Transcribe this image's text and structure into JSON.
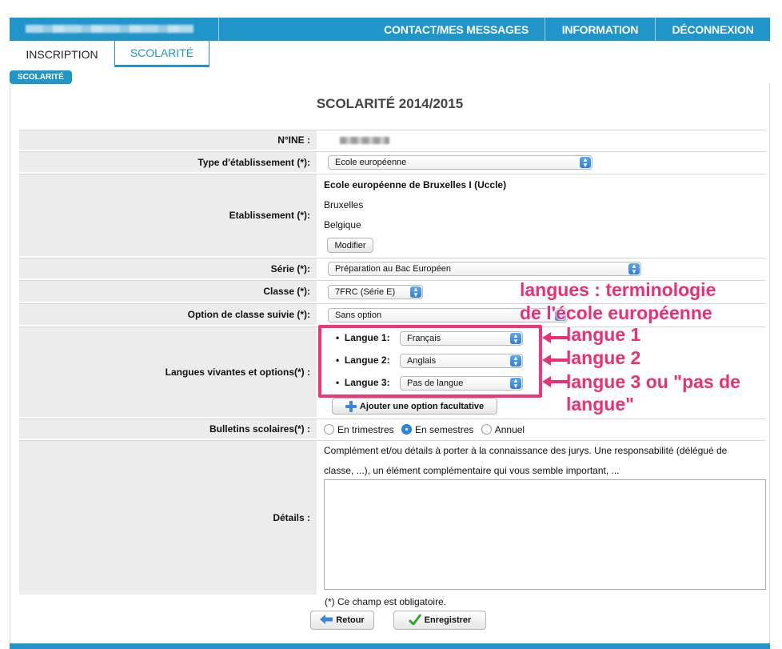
{
  "nav": {
    "contact": "CONTACT/MES MESSAGES",
    "information": "INFORMATION",
    "logout": "DÉCONNEXION"
  },
  "tabs": {
    "inscription": "INSCRIPTION",
    "scolarite": "SCOLARITÉ"
  },
  "badge": "SCOLARITÉ",
  "page_title": "SCOLARITÉ 2014/2015",
  "form": {
    "ine_label": "N°INE :",
    "type_label": "Type d'établissement (*):",
    "type_value": "Ecole européenne",
    "etab_label": "Etablissement (*):",
    "etab_name": "Ecole européenne de Bruxelles I (Uccle)",
    "etab_city": "Bruxelles",
    "etab_country": "Belgique",
    "modify_button": "Modifier",
    "serie_label": "Série (*):",
    "serie_value": "Préparation au Bac Européen",
    "classe_label": "Classe (*):",
    "classe_value": "7FRC (Série E)",
    "option_label": "Option de classe suivie (*):",
    "option_value": "Sans option",
    "langues_label": "Langues vivantes et options(*) :",
    "langues": [
      {
        "label": "Langue 1",
        "value": "Français"
      },
      {
        "label": "Langue 2",
        "value": "Anglais"
      },
      {
        "label": "Langue 3",
        "value": "Pas de langue"
      }
    ],
    "add_option_button": "Ajouter une option facultative",
    "bulletins_label": "Bulletins scolaires(*) :",
    "bulletins_options": [
      "En trimestres",
      "En semestres",
      "Annuel"
    ],
    "bulletins_selected": "En semestres",
    "details_label": "Détails :",
    "details_help_1": "Complément et/ou détails à porter à la connaissance des jurys. Une responsabilité (délégué de",
    "details_help_2": "classe, ...), un élément complémentaire qui vous semble important, ...",
    "details_value": "",
    "required_note": "(*) Ce champ est obligatoire.",
    "back_button": "Retour",
    "save_button": "Enregistrer"
  },
  "annotations": {
    "header_line1": "langues : terminologie",
    "header_line2": "de l'école européenne",
    "l1": "langue 1",
    "l2": "langue 2",
    "l3_line1": "langue 3 ou \"pas de",
    "l3_line2": "langue\""
  },
  "colors": {
    "accent": "#1f95c9",
    "annotation": "#ea2f74",
    "label_bg": "#ececec"
  }
}
